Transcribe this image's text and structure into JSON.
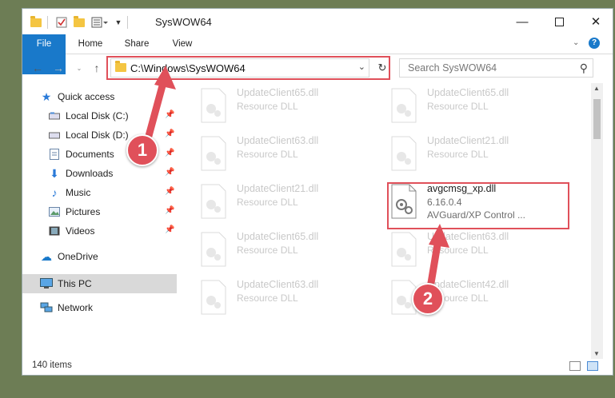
{
  "window": {
    "title": "SysWOW64"
  },
  "tabs": [
    {
      "label": "File"
    },
    {
      "label": "Home"
    },
    {
      "label": "Share"
    },
    {
      "label": "View"
    }
  ],
  "address": {
    "path": "C:\\Windows\\SysWOW64"
  },
  "search": {
    "placeholder": "Search SysWOW64"
  },
  "sidebar": {
    "items": [
      {
        "label": "Quick access"
      },
      {
        "label": "Local Disk (C:)"
      },
      {
        "label": "Local Disk (D:)"
      },
      {
        "label": "Documents"
      },
      {
        "label": "Downloads"
      },
      {
        "label": "Music"
      },
      {
        "label": "Pictures"
      },
      {
        "label": "Videos"
      },
      {
        "label": "OneDrive"
      },
      {
        "label": "This PC"
      },
      {
        "label": "Network"
      }
    ]
  },
  "files": [
    {
      "name": "UpdateClient65.dll",
      "type": "Resource DLL"
    },
    {
      "name": "UpdateClient65.dll",
      "type": "Resource DLL"
    },
    {
      "name": "UpdateClient63.dll",
      "type": "Resource DLL"
    },
    {
      "name": "UpdateClient21.dll",
      "type": "Resource DLL"
    },
    {
      "name": "UpdateClient21.dll",
      "type": "Resource DLL"
    },
    {
      "name": "avgcmsg_xp.dll",
      "version": "6.16.0.4",
      "description": "AVGuard/XP Control ..."
    },
    {
      "name": "UpdateClient65.dll",
      "type": "Resource DLL"
    },
    {
      "name": "UpdateClient63.dll",
      "type": "Resource DLL"
    },
    {
      "name": "UpdateClient63.dll",
      "type": "Resource DLL"
    },
    {
      "name": "UpdateClient42.dll",
      "type": "Resource DLL"
    }
  ],
  "status": {
    "item_count": "140 items"
  },
  "callouts": {
    "one": "1",
    "two": "2"
  },
  "colors": {
    "accent": "#1979ca",
    "highlight": "#e0505a"
  }
}
